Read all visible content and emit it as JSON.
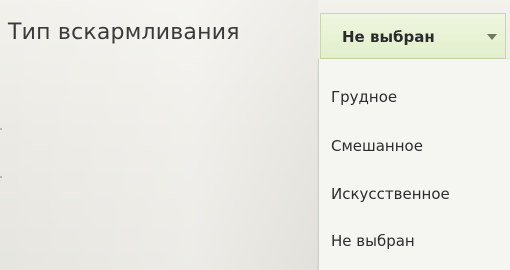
{
  "field": {
    "label": "Тип вскармливания",
    "selected": "Не выбран"
  },
  "dropdown": {
    "options": [
      "Грудное",
      "Смешанное",
      "Искусственное",
      "Не выбран"
    ]
  },
  "icons": {
    "dropdown_arrow": "chevron-down-icon"
  },
  "colors": {
    "select_background": "#e3efcc",
    "dropdown_background": "#f5f6f1"
  }
}
